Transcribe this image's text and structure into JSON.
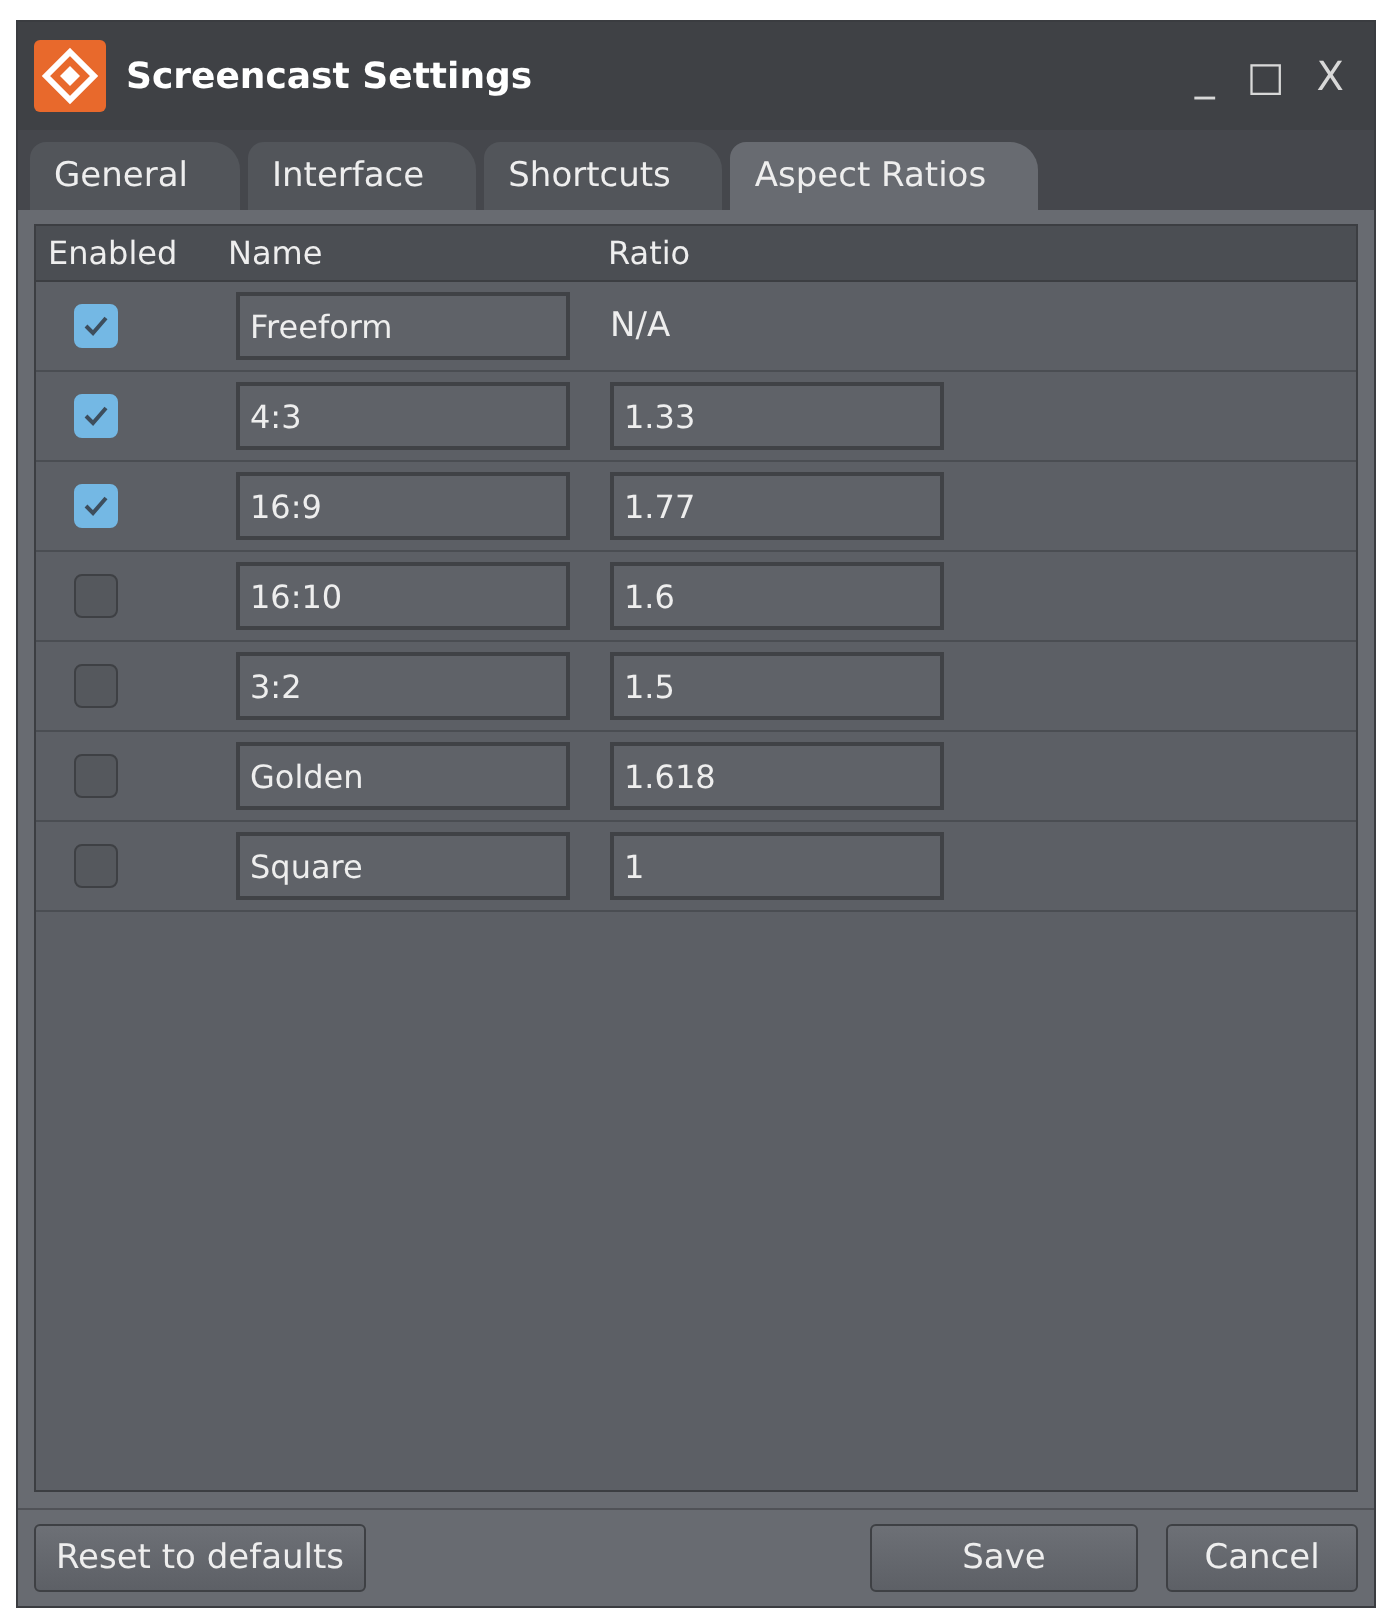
{
  "window": {
    "title": "Screencast Settings",
    "controls": [
      "_",
      "□",
      "X"
    ]
  },
  "tabs": [
    {
      "label": "General",
      "selected": false
    },
    {
      "label": "Interface",
      "selected": false
    },
    {
      "label": "Shortcuts",
      "selected": false
    },
    {
      "label": "Aspect Ratios",
      "selected": true
    }
  ],
  "table": {
    "columns": [
      "Enabled",
      "Name",
      "Ratio"
    ],
    "rows": [
      {
        "enabled": true,
        "name": "Freeform",
        "ratio": "N/A",
        "kind": "fixed"
      },
      {
        "enabled": true,
        "name": "4:3",
        "ratio": "1.33",
        "kind": "editable"
      },
      {
        "enabled": true,
        "name": "16:9",
        "ratio": "1.77",
        "kind": "editable"
      },
      {
        "enabled": false,
        "name": "16:10",
        "ratio": "1.6",
        "kind": "editable"
      },
      {
        "enabled": false,
        "name": "3:2",
        "ratio": "1.5",
        "kind": "editable"
      },
      {
        "enabled": false,
        "name": "Golden",
        "ratio": "1.618",
        "kind": "editable"
      },
      {
        "enabled": false,
        "name": "Square",
        "ratio": "1",
        "kind": "editable"
      }
    ]
  },
  "footer": {
    "reset": "Reset to defaults",
    "save": "Save",
    "cancel": "Cancel"
  }
}
